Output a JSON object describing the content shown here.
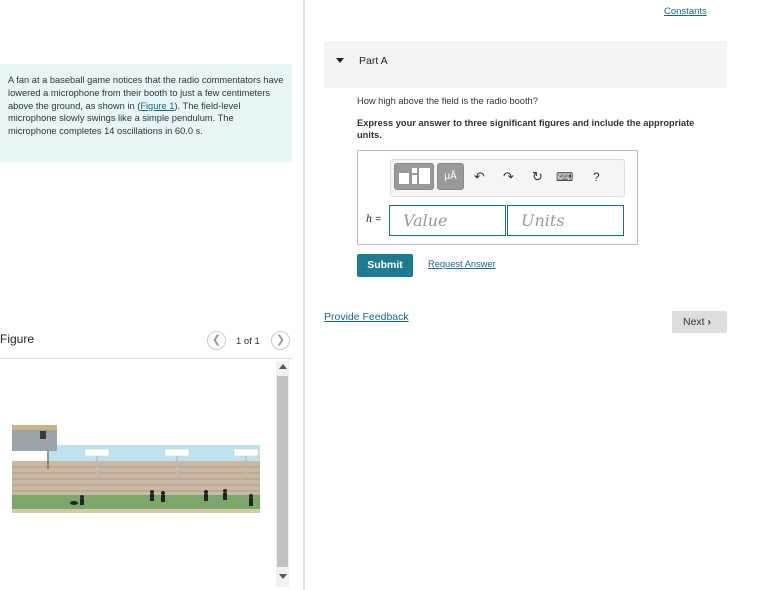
{
  "problem": {
    "text_before": "A fan at a baseball game notices that the radio commentators have lowered a microphone from their booth to just a few centimeters above the ground, as shown in (",
    "figure_link": "Figure 1",
    "text_after": "). The field-level microphone slowly swings like a simple pendulum. The microphone completes 14 oscillations in 60.0",
    "unit": "s",
    "period": "."
  },
  "figure": {
    "title": "Figure",
    "pager": "1 of 1",
    "prev_icon": "chevron-left-icon",
    "next_icon": "chevron-right-icon"
  },
  "header": {
    "constants_link": "Constants"
  },
  "part": {
    "title": "Part A",
    "question": "How high above the field is the radio booth?",
    "instructions": "Express your answer to three significant figures and include the appropriate units."
  },
  "toolbar": {
    "mu_label": "μÅ",
    "undo_icon": "↶",
    "redo_icon": "↷",
    "reset_icon": "↻",
    "keyboard_icon": "⌨",
    "help_icon": "?"
  },
  "answer": {
    "variable": "h",
    "equals": " =",
    "value_placeholder": "Value",
    "units_placeholder": "Units"
  },
  "actions": {
    "submit": "Submit",
    "request_answer": "Request Answer",
    "provide_feedback": "Provide Feedback",
    "next": "Next",
    "next_icon": "›"
  },
  "colors": {
    "accent": "#1a6a8c",
    "submit_bg": "#1c7a92",
    "problem_bg": "#e6f5f6"
  }
}
